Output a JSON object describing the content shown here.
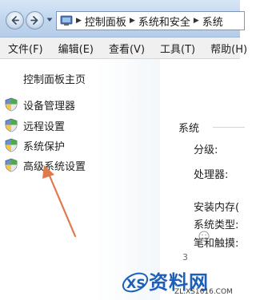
{
  "address_bar": {
    "breadcrumbs": [
      "控制面板",
      "系统和安全",
      "系统"
    ]
  },
  "menu": {
    "items": [
      "文件(F)",
      "编辑(E)",
      "查看(V)",
      "工具(T)",
      "帮助(H)"
    ]
  },
  "left_pane": {
    "home_label": "控制面板主页",
    "links": [
      {
        "label": "设备管理器",
        "icon": "uac-shield-icon"
      },
      {
        "label": "远程设置",
        "icon": "uac-shield-icon"
      },
      {
        "label": "系统保护",
        "icon": "uac-shield-icon"
      },
      {
        "label": "高级系统设置",
        "icon": "uac-shield-icon"
      }
    ]
  },
  "system_section": {
    "title": "系统",
    "labels": [
      "分级:",
      "处理器:",
      "安装内存(",
      "系统类型:",
      "笔和触摸:"
    ]
  },
  "watermark": {
    "mark_text": "3"
  },
  "logo": {
    "name": "资料网",
    "url": "ZL.XS1616.COM"
  },
  "colors": {
    "titlebar": "#c3d8ef",
    "arrow": "#e07a4a",
    "logo_blue": "#1c5fb8",
    "link_text": "#1e1e1e"
  }
}
